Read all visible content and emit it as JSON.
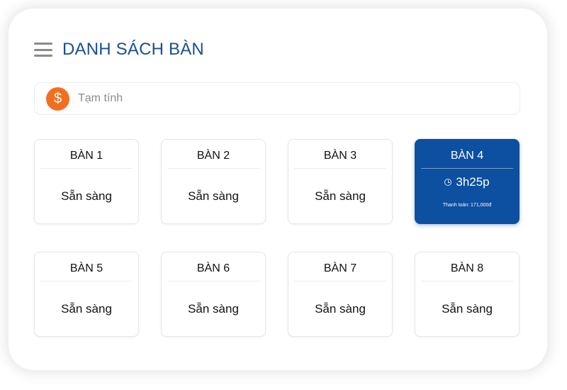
{
  "header": {
    "title": "DANH SÁCH BÀN",
    "menu_icon": "hamburger-menu-icon"
  },
  "subtotal": {
    "icon": "dollar-icon",
    "icon_glyph": "$",
    "label": "Tạm tính"
  },
  "colors": {
    "title": "#1a4f93",
    "active_table": "#0d4fa0",
    "dollar_badge": "#f26f21"
  },
  "tables": [
    {
      "name": "BÀN 1",
      "status": "Sẵn sàng"
    },
    {
      "name": "BÀN 2",
      "status": "Sẵn sàng"
    },
    {
      "name": "BÀN 3",
      "status": "Sẵn sàng"
    },
    {
      "name": "BÀN 4",
      "timer": "3h25p",
      "payment": "Thanh toán: 171,000đ",
      "active": true
    },
    {
      "name": "BÀN 5",
      "status": "Sẵn sàng"
    },
    {
      "name": "BÀN 6",
      "status": "Sẵn sàng"
    },
    {
      "name": "BÀN 7",
      "status": "Sẵn sàng"
    },
    {
      "name": "BÀN 8",
      "status": "Sẵn sàng"
    }
  ]
}
